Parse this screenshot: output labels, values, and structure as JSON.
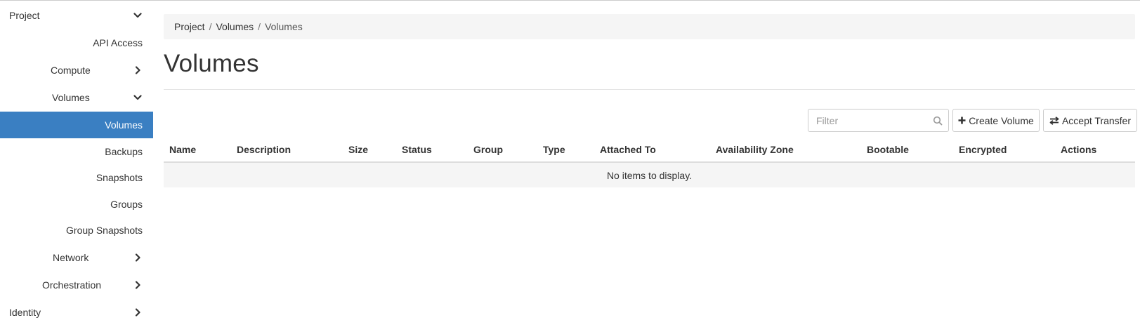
{
  "sidebar": {
    "project": "Project",
    "api_access": "API Access",
    "compute": "Compute",
    "volumes_group": "Volumes",
    "volumes": "Volumes",
    "backups": "Backups",
    "snapshots": "Snapshots",
    "groups": "Groups",
    "group_snapshots": "Group Snapshots",
    "network": "Network",
    "orchestration": "Orchestration",
    "identity": "Identity",
    "active_color": "#3a7fc2"
  },
  "breadcrumb": {
    "items": [
      "Project",
      "Volumes",
      "Volumes"
    ],
    "separator": "/"
  },
  "page": {
    "title": "Volumes"
  },
  "toolbar": {
    "filter_placeholder": "Filter",
    "create_label": "Create Volume",
    "transfer_label": "Accept Transfer"
  },
  "table": {
    "columns": [
      "Name",
      "Description",
      "Size",
      "Status",
      "Group",
      "Type",
      "Attached To",
      "Availability Zone",
      "Bootable",
      "Encrypted",
      "Actions"
    ],
    "empty_message": "No items to display."
  },
  "icons": {
    "sidebar_expanded": "chevron-down-icon",
    "sidebar_collapsed": "chevron-right-icon",
    "filter": "search-icon",
    "create": "plus-icon",
    "transfer": "exchange-icon"
  }
}
